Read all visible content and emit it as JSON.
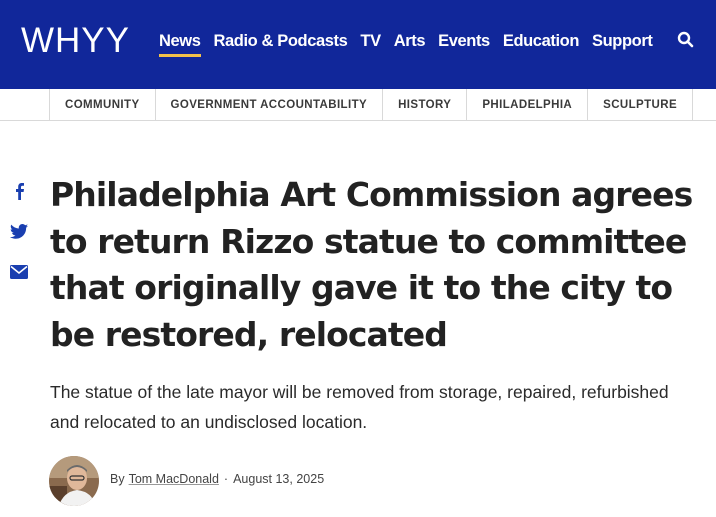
{
  "colors": {
    "header_bg": "#11279a",
    "active_underline": "#f3c24a",
    "share_icon": "#1a3fb0"
  },
  "header": {
    "logo": "WHYY",
    "nav": [
      {
        "label": "News",
        "active": true
      },
      {
        "label": "Radio & Podcasts"
      },
      {
        "label": "TV"
      },
      {
        "label": "Arts"
      },
      {
        "label": "Events"
      },
      {
        "label": "Education"
      },
      {
        "label": "Support"
      }
    ],
    "search_icon": "search-icon"
  },
  "tags": [
    "COMMUNITY",
    "GOVERNMENT ACCOUNTABILITY",
    "HISTORY",
    "PHILADELPHIA",
    "SCULPTURE"
  ],
  "share_icons": [
    "facebook-icon",
    "twitter-icon",
    "email-icon"
  ],
  "article": {
    "headline": "Philadelphia Art Commission agrees to return Rizzo statue to committee that originally gave it to the city to be restored, relocated",
    "dek": "The statue of the late mayor will be removed from storage, repaired, refurbished and relocated to an undisclosed location.",
    "byline_prefix": "By",
    "author": "Tom MacDonald",
    "separator": "·",
    "date": "August 13, 2025"
  }
}
